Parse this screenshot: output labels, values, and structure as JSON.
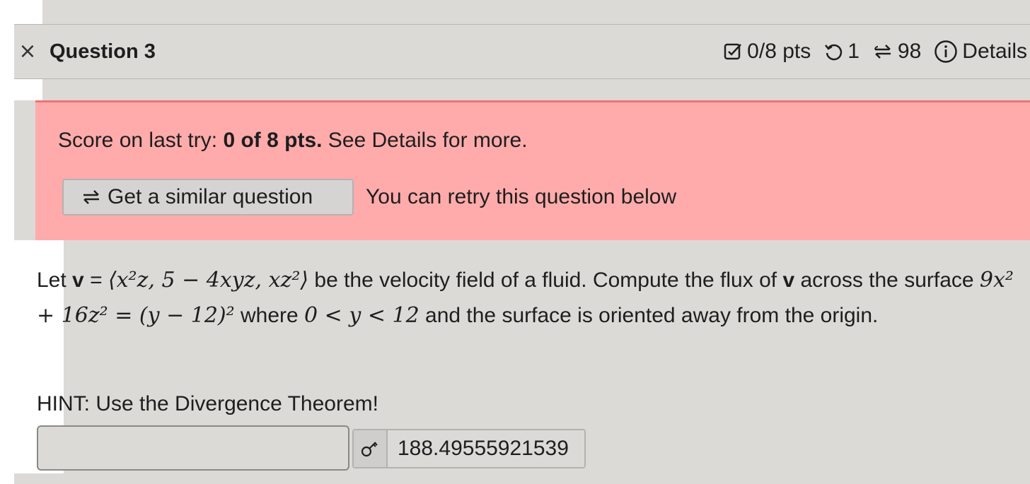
{
  "header": {
    "close_symbol": "×",
    "title": "Question 3",
    "points": "0/8 pts",
    "retry_count": "1",
    "attempts_remaining": "98",
    "details_label": "Details"
  },
  "alert": {
    "score_prefix": "Score on last try: ",
    "score_bold": "0 of 8 pts.",
    "score_suffix": " See Details for more.",
    "similar_button": "Get a similar question",
    "retry_note": "You can retry this question below"
  },
  "question": {
    "let": "Let ",
    "v": "v",
    "eq": " = ",
    "field": "⟨x²z, 5 − 4xyz, xz²⟩",
    "text1": " be the velocity field of a fluid. Compute the flux of ",
    "v2": "v",
    "text2": " across the surface ",
    "surface": "9x² + 16z² = (y − 12)²",
    "text3": " where ",
    "range": "0 < y < 12",
    "text4": " and the surface is oriented away from the origin."
  },
  "hint": "HINT: Use the Divergence Theorem!",
  "answer": {
    "input_value": "",
    "key_value": "188.49555921539"
  },
  "icons": {
    "points": "checkbox-icon",
    "retry": "retry-icon",
    "similar": "similar-icon",
    "details": "info-icon",
    "key": "key-icon"
  },
  "colors": {
    "alert_bg": "#ffabab",
    "alert_border": "#ef7474",
    "page_bg": "#dcdad7"
  }
}
